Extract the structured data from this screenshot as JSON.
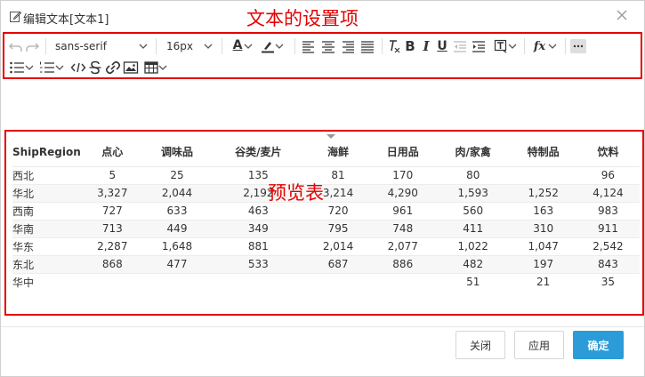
{
  "dialog": {
    "title": "编辑文本[文本1]",
    "close_icon": "close-icon"
  },
  "annotations": {
    "toolbar_label": "文本的设置项",
    "preview_label": "预览表",
    "color": "#e60000"
  },
  "toolbar": {
    "font_family": "sans-serif",
    "font_size": "16px",
    "row1_icons": [
      "undo-icon",
      "redo-icon",
      "font-color-icon",
      "highlight-color-icon",
      "align-left-icon",
      "align-center-icon",
      "align-right-icon",
      "align-justify-icon",
      "clear-format-icon",
      "bold-icon",
      "italic-icon",
      "underline-icon",
      "outdent-icon",
      "indent-icon",
      "paragraph-format-icon",
      "formula-icon",
      "more-icon"
    ],
    "row2_icons": [
      "unordered-list-icon",
      "ordered-list-icon",
      "code-icon",
      "strikethrough-icon",
      "link-icon",
      "image-icon",
      "table-icon"
    ],
    "bold_glyph": "B",
    "italic_glyph": "I",
    "underline_glyph": "U",
    "formula_glyph": "fx",
    "font_color_glyph": "A"
  },
  "preview": {
    "headers": [
      "ShipRegion",
      "点心",
      "调味品",
      "谷类/麦片",
      "海鲜",
      "日用品",
      "肉/家禽",
      "特制品",
      "饮料"
    ],
    "rows": [
      [
        "西北",
        "5",
        "25",
        "135",
        "81",
        "170",
        "80",
        "",
        "96"
      ],
      [
        "华北",
        "3,327",
        "2,044",
        "2,192",
        "3,214",
        "4,290",
        "1,593",
        "1,252",
        "4,124"
      ],
      [
        "西南",
        "727",
        "633",
        "463",
        "720",
        "961",
        "560",
        "163",
        "983"
      ],
      [
        "华南",
        "713",
        "449",
        "349",
        "795",
        "748",
        "411",
        "310",
        "911"
      ],
      [
        "华东",
        "2,287",
        "1,648",
        "881",
        "2,014",
        "2,077",
        "1,022",
        "1,047",
        "2,542"
      ],
      [
        "东北",
        "868",
        "477",
        "533",
        "687",
        "886",
        "482",
        "197",
        "843"
      ],
      [
        "华中",
        "",
        "",
        "",
        "",
        "",
        "51",
        "21",
        "35"
      ]
    ]
  },
  "footer": {
    "close_label": "关闭",
    "apply_label": "应用",
    "ok_label": "确定",
    "ok_color": "#2b9cd8"
  }
}
